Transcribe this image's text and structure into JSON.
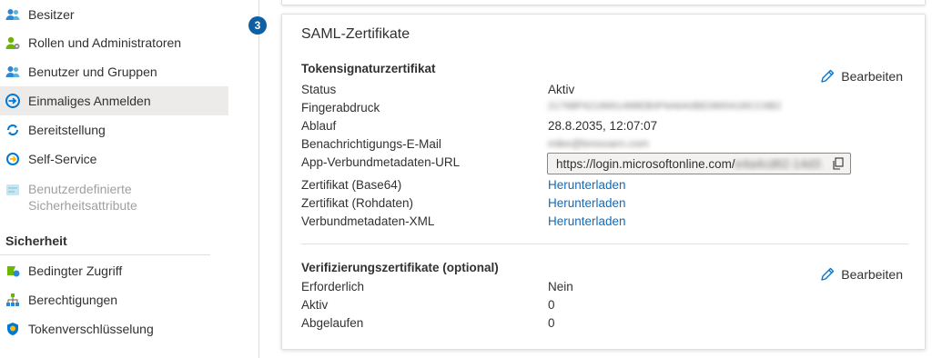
{
  "sidebar": {
    "items": [
      {
        "label": "Besitzer",
        "icon": "owners-icon"
      },
      {
        "label": "Rollen und Administratoren",
        "icon": "roles-icon"
      },
      {
        "label": "Benutzer und Gruppen",
        "icon": "users-groups-icon"
      },
      {
        "label": "Einmaliges Anmelden",
        "icon": "single-sign-on-icon",
        "active": true
      },
      {
        "label": "Bereitstellung",
        "icon": "provisioning-icon"
      },
      {
        "label": "Self-Service",
        "icon": "self-service-icon"
      },
      {
        "label_line1": "Benutzerdefinierte",
        "label_line2": "Sicherheitsattribute",
        "icon": "custom-attributes-icon",
        "disabled": true
      }
    ],
    "security_section": {
      "title": "Sicherheit",
      "items": [
        {
          "label": "Bedingter Zugriff",
          "icon": "conditional-access-icon"
        },
        {
          "label": "Berechtigungen",
          "icon": "permissions-icon"
        },
        {
          "label": "Tokenverschlüsselung",
          "icon": "token-encryption-icon"
        }
      ]
    }
  },
  "main": {
    "step_number": "3",
    "card": {
      "title": "SAML-Zertifikate",
      "token_section": {
        "title": "Tokensignaturzertifikat",
        "edit_label": "Bearbeiten",
        "rows": {
          "status": {
            "label": "Status",
            "value": "Aktiv"
          },
          "thumbprint": {
            "label": "Fingerabdruck",
            "value": "2176BF6218661488EB0F6A6A0BE0865418ICC6B2"
          },
          "expiry": {
            "label": "Ablauf",
            "value": "28.8.2035, 12:07:07"
          },
          "notify_email": {
            "label": "Benachrichtigungs-E-Mail",
            "value": "mike@bresoarn.com"
          },
          "metadata_url": {
            "label": "App-Verbundmetadaten-URL",
            "value": "https://login.microsoftonline.com/",
            "value_blurred": "e4a4cd62-14d3 ..."
          },
          "cert_base64": {
            "label": "Zertifikat (Base64)",
            "link": "Herunterladen"
          },
          "cert_raw": {
            "label": "Zertifikat (Rohdaten)",
            "link": "Herunterladen"
          },
          "federation_xml": {
            "label": "Verbundmetadaten-XML",
            "link": "Herunterladen"
          }
        }
      },
      "verification_section": {
        "title": "Verifizierungszertifikate (optional)",
        "edit_label": "Bearbeiten",
        "rows": {
          "required": {
            "label": "Erforderlich",
            "value": "Nein"
          },
          "active": {
            "label": "Aktiv",
            "value": "0"
          },
          "expired": {
            "label": "Abgelaufen",
            "value": "0"
          }
        }
      }
    }
  },
  "colors": {
    "accent": "#0f6cbd",
    "step_badge": "#0f5fa3",
    "active_nav_bg": "#edebe9"
  }
}
